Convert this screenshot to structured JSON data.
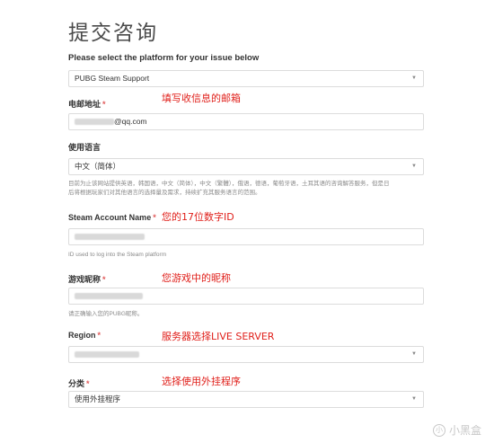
{
  "page": {
    "title": "提交咨询",
    "intro": "Please select the platform for your issue below"
  },
  "platform": {
    "selected": "PUBG Steam Support"
  },
  "email": {
    "label": "电邮地址",
    "value_suffix": "@qq.com",
    "annotation": "填写收信息的邮箱"
  },
  "language": {
    "label": "使用语言",
    "selected": "中文（简体）",
    "hint_line1": "目前为止该网站提供英语，韩国语，中文（简体），中文（繁體），俄语，德语，葡萄牙语，土耳其语的咨询解答服务，但是日",
    "hint_line2": "后将根据玩家们对其他语言的选择量及需求，持续扩充其服务语言的范围。"
  },
  "steam_account": {
    "label": "Steam Account Name",
    "hint": "ID used to log into the Steam platform",
    "annotation": "您的17位数字ID"
  },
  "nickname": {
    "label": "游戏昵称",
    "hint": "请正确输入您的PUBG昵称。",
    "annotation": "您游戏中的昵称"
  },
  "region": {
    "label": "Region",
    "annotation": "服务器选择LIVE SERVER"
  },
  "category": {
    "label": "分类",
    "selected": "使用外挂程序",
    "annotation": "选择使用外挂程序"
  },
  "required_mark": "*",
  "watermark": {
    "icon_glyph": "小",
    "text": "小黑盒"
  },
  "colors": {
    "annotation": "#e0201b",
    "required": "#e05a5a",
    "border": "#dcdcdc"
  }
}
